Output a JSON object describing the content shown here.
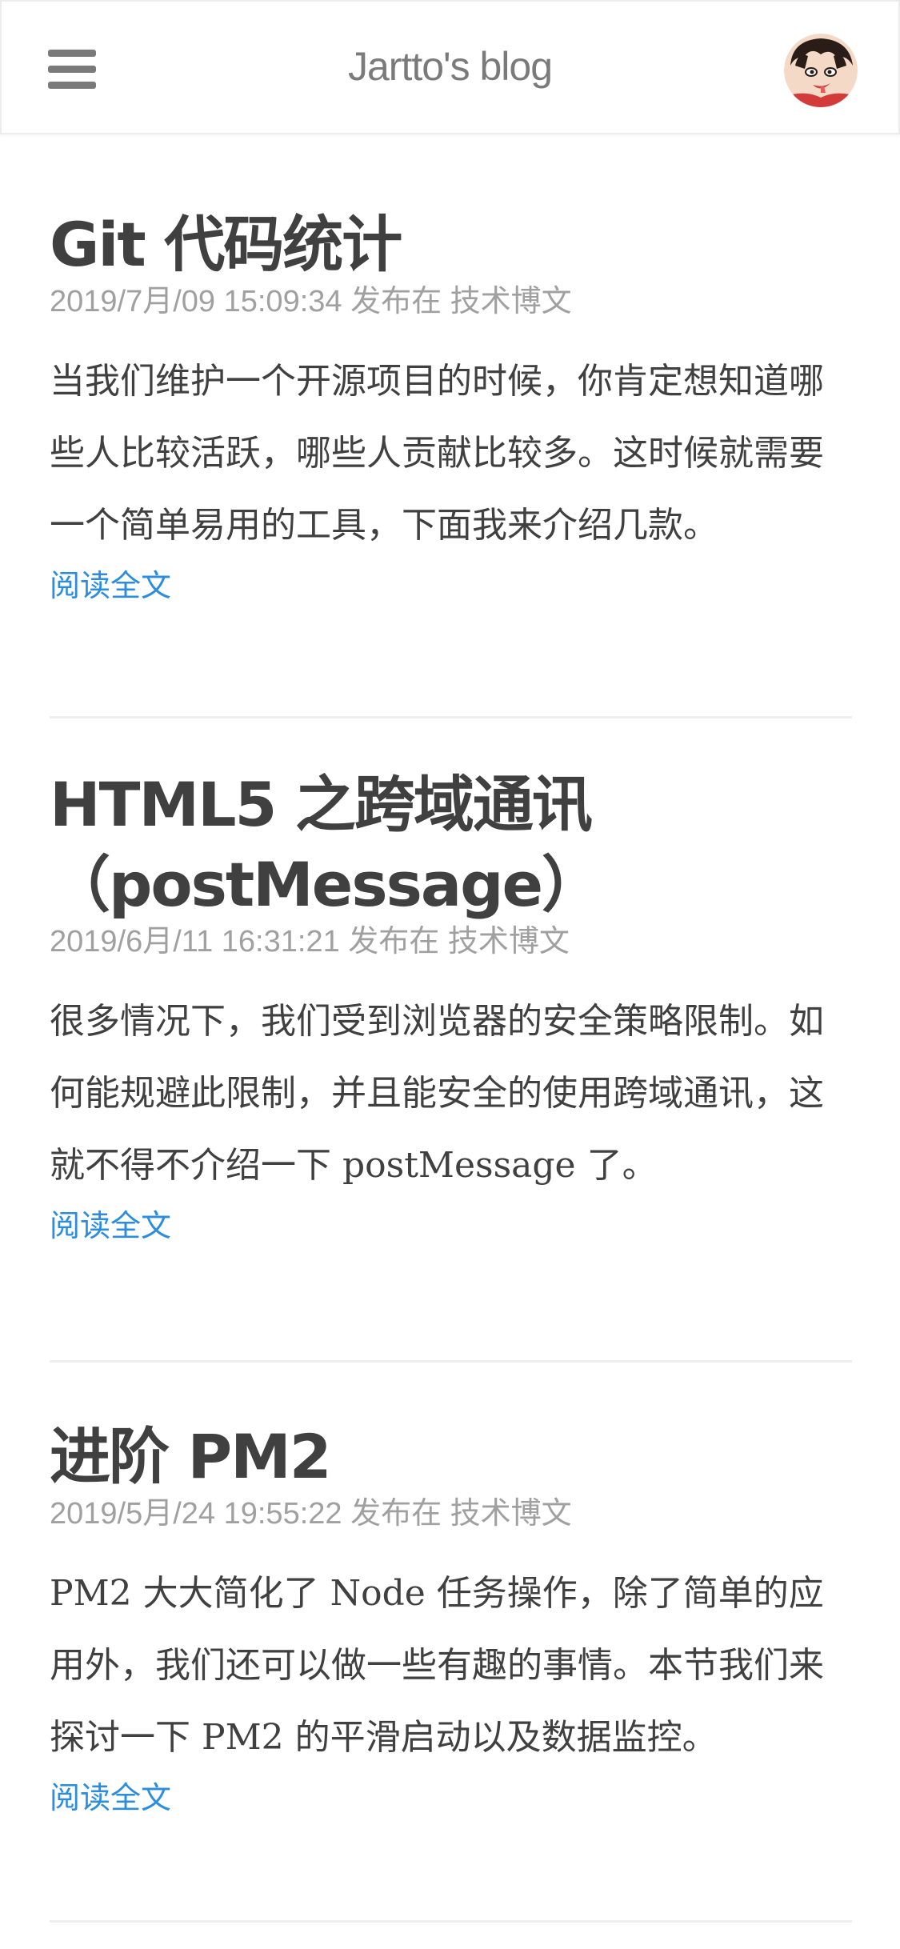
{
  "header": {
    "title": "Jartto's blog",
    "menu_icon": "hamburger-menu-icon",
    "avatar_alt": "avatar"
  },
  "colors": {
    "text": "#404040",
    "meta": "#a0a0a0",
    "link": "#2b8ce0",
    "divider": "#eeeeee",
    "header_icon": "#7a7a7a"
  },
  "posts": [
    {
      "title": "Git 代码统计",
      "date": "2019/7月/09 15:09:34",
      "published_in": "发布在",
      "category": "技术博文",
      "excerpt": "当我们维护一个开源项目的时候，你肯定想知道哪些人比较活跃，哪些人贡献比较多。这时候就需要一个简单易用的工具，下面我来介绍几款。",
      "read_more": "阅读全文"
    },
    {
      "title": "HTML5 之跨域通讯（postMessage）",
      "date": "2019/6月/11 16:31:21",
      "published_in": "发布在",
      "category": "技术博文",
      "excerpt": "很多情况下，我们受到浏览器的安全策略限制。如何能规避此限制，并且能安全的使用跨域通讯，这就不得不介绍一下 postMessage 了。",
      "read_more": "阅读全文"
    },
    {
      "title": "进阶 PM2",
      "date": "2019/5月/24 19:55:22",
      "published_in": "发布在",
      "category": "技术博文",
      "excerpt": "PM2 大大简化了 Node 任务操作，除了简单的应用外，我们还可以做一些有趣的事情。本节我们来探讨一下 PM2 的平滑启动以及数据监控。",
      "read_more": "阅读全文"
    }
  ]
}
